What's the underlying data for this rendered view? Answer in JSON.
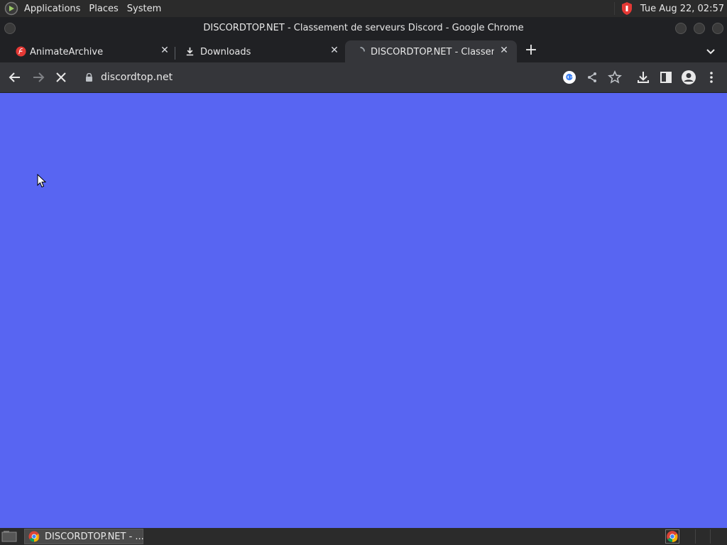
{
  "system_bar": {
    "menu": [
      "Applications",
      "Places",
      "System"
    ],
    "clock": "Tue Aug 22, 02:57"
  },
  "window": {
    "title": "DISCORDTOP.NET - Classement de serveurs Discord - Google Chrome"
  },
  "tabs": [
    {
      "label": "AnimateArchive",
      "icon": "flash-icon"
    },
    {
      "label": "Downloads",
      "icon": "download-icon"
    },
    {
      "label": "DISCORDTOP.NET - Classement de serveurs Discord",
      "icon": "loading-icon",
      "active": true
    }
  ],
  "toolbar": {
    "url": "discordtop.net"
  },
  "page": {
    "background": "#5865f2"
  },
  "taskbar": {
    "task_label": "DISCORDTOP.NET - ..."
  }
}
